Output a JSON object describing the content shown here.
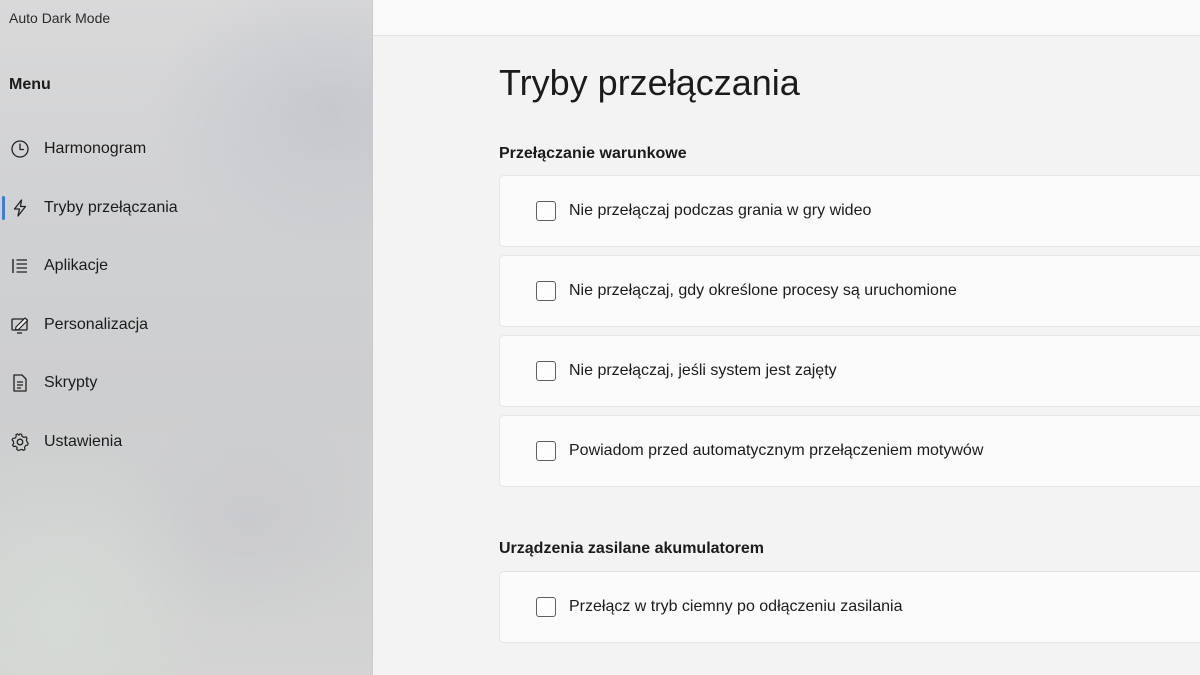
{
  "app": {
    "title": "Auto Dark Mode"
  },
  "sidebar": {
    "menu_title": "Menu",
    "accent_color": "#3d7bd9",
    "items": [
      {
        "label": "Harmonogram",
        "icon": "clock-icon",
        "selected": false
      },
      {
        "label": "Tryby przełączania",
        "icon": "lightning-icon",
        "selected": true
      },
      {
        "label": "Aplikacje",
        "icon": "list-icon",
        "selected": false
      },
      {
        "label": "Personalizacja",
        "icon": "personalize-icon",
        "selected": false
      },
      {
        "label": "Skrypty",
        "icon": "document-icon",
        "selected": false
      },
      {
        "label": "Ustawienia",
        "icon": "gear-icon",
        "selected": false
      }
    ]
  },
  "main": {
    "page_title": "Tryby przełączania",
    "sections": [
      {
        "title": "Przełączanie warunkowe",
        "options": [
          {
            "label": "Nie przełączaj podczas grania w gry wideo",
            "checked": false
          },
          {
            "label": "Nie przełączaj, gdy określone procesy są uruchomione",
            "checked": false
          },
          {
            "label": "Nie przełączaj, jeśli system jest zajęty",
            "checked": false
          },
          {
            "label": "Powiadom przed automatycznym przełączeniem motywów",
            "checked": false
          }
        ]
      },
      {
        "title": "Urządzenia zasilane akumulatorem",
        "options": [
          {
            "label": "Przełącz w tryb ciemny po odłączeniu zasilania",
            "checked": false
          }
        ]
      }
    ]
  }
}
